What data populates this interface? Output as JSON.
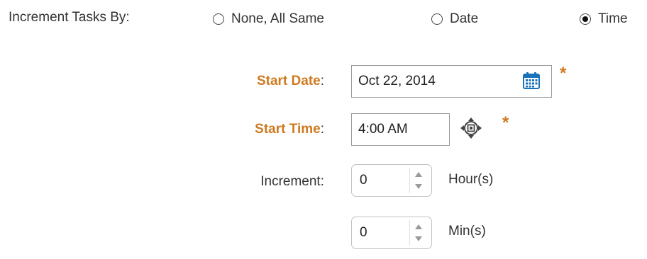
{
  "increment": {
    "label": "Increment Tasks By:",
    "options": [
      {
        "label": "None, All Same",
        "selected": false
      },
      {
        "label": "Date",
        "selected": false
      },
      {
        "label": "Time",
        "selected": true
      }
    ]
  },
  "start_date": {
    "label": "Start Date",
    "colon": ":",
    "value": "Oct 22, 2014",
    "required_mark": "*",
    "icon": "calendar-icon"
  },
  "start_time": {
    "label": "Start Time",
    "colon": ":",
    "value": "4:00 AM",
    "required_mark": "*",
    "icon": "time-picker-icon"
  },
  "increment_amount": {
    "label": "Increment:",
    "hours": {
      "value": "0",
      "unit": "Hour(s)"
    },
    "minutes": {
      "value": "0",
      "unit": "Min(s)"
    }
  },
  "colors": {
    "required_label": "#cf7a1e",
    "text": "#333333",
    "calendar_icon": "#1a73b8"
  }
}
